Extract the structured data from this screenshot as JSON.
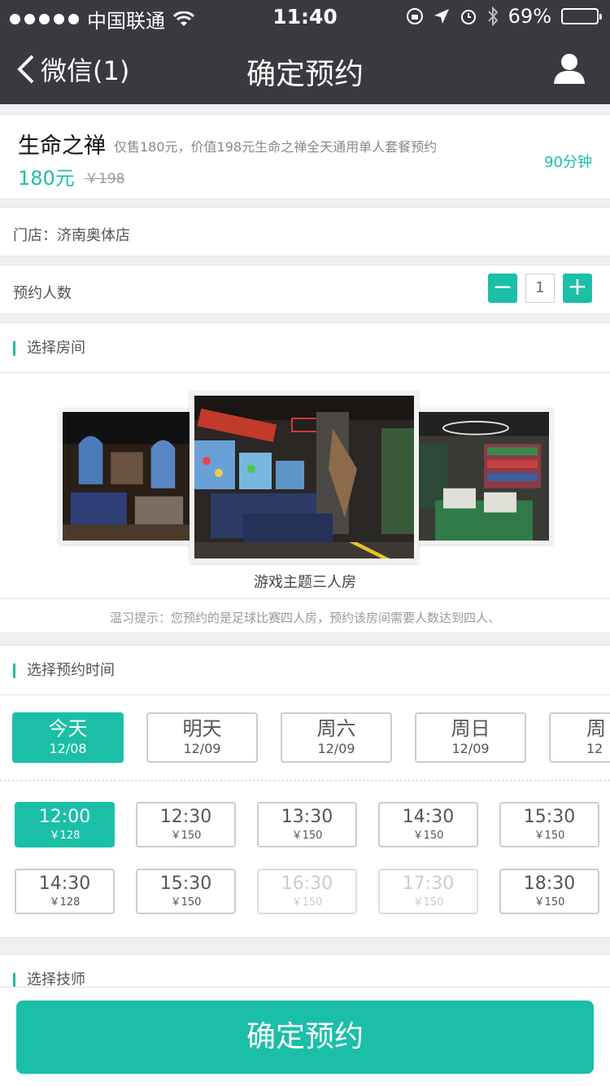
{
  "status_bar": {
    "carrier": "中国联通",
    "time": "11:40",
    "battery": "69%",
    "battery_level": 0.69
  },
  "nav": {
    "back_label": "微信(1)",
    "title": "确定预约"
  },
  "product": {
    "name": "生命之禅",
    "description": "仅售180元，价值198元生命之禅全天通用单人套餐预约",
    "price": "180元",
    "original_price": "￥198",
    "duration": "90分钟"
  },
  "store": {
    "label": "门店：济南奥体店"
  },
  "people": {
    "label": "预约人数",
    "minus": "−",
    "plus": "+",
    "count": "1"
  },
  "rooms": {
    "title": "选择房间",
    "selected_name": "游戏主题三人房",
    "tip": "温习提示：您预约的是足球比赛四人房，预约该房间需要人数达到四人、"
  },
  "times": {
    "title": "选择预约时间",
    "days": [
      {
        "label": "今天",
        "date": "12/08"
      },
      {
        "label": "明天",
        "date": "12/09"
      },
      {
        "label": "周六",
        "date": "12/09"
      },
      {
        "label": "周日",
        "date": "12/09"
      },
      {
        "label": "周",
        "date": "12"
      }
    ],
    "slots": [
      {
        "time": "12:00",
        "price": "￥128"
      },
      {
        "time": "12:30",
        "price": "￥150"
      },
      {
        "time": "13:30",
        "price": "￥150"
      },
      {
        "time": "14:30",
        "price": "￥150"
      },
      {
        "time": "15:30",
        "price": "￥150"
      },
      {
        "time": "14:30",
        "price": "￥128"
      },
      {
        "time": "15:30",
        "price": "￥150"
      },
      {
        "time": "16:30",
        "price": "￥150"
      },
      {
        "time": "17:30",
        "price": "￥150"
      },
      {
        "time": "18:30",
        "price": "￥150"
      }
    ]
  },
  "technician": {
    "title": "选择技师"
  },
  "footer": {
    "confirm_label": "确定预约"
  },
  "colors": {
    "accent": "#1bbfa7",
    "navbar": "#393a3f"
  }
}
